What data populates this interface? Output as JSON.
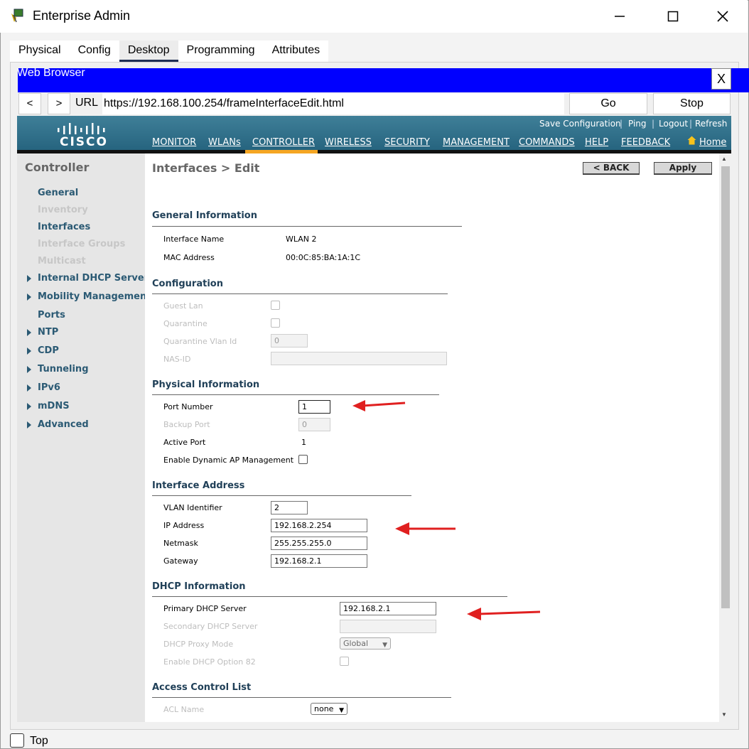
{
  "window": {
    "title": "Enterprise Admin"
  },
  "tabs": [
    {
      "label": "Physical"
    },
    {
      "label": "Config"
    },
    {
      "label": "Desktop"
    },
    {
      "label": "Programming"
    },
    {
      "label": "Attributes"
    }
  ],
  "browser": {
    "title": "Web Browser",
    "close_label": "X",
    "back_label": "<",
    "forward_label": ">",
    "url_label": "URL",
    "url": "https://192.168.100.254/frameInterfaceEdit.html",
    "go_label": "Go",
    "stop_label": "Stop"
  },
  "cisco": {
    "brand": "CISCO",
    "top_links": [
      "Save Configuration",
      "Ping",
      "Logout",
      "Refresh"
    ],
    "menu": [
      "MONITOR",
      "WLANs",
      "CONTROLLER",
      "WIRELESS",
      "SECURITY",
      "MANAGEMENT",
      "COMMANDS",
      "HELP",
      "FEEDBACK"
    ],
    "home_label": "Home",
    "active_menu": "CONTROLLER"
  },
  "sidebar": {
    "title": "Controller",
    "items": [
      {
        "label": "General",
        "disabled": false,
        "arrow": false
      },
      {
        "label": "Inventory",
        "disabled": true,
        "arrow": false
      },
      {
        "label": "Interfaces",
        "disabled": false,
        "arrow": false
      },
      {
        "label": "Interface Groups",
        "disabled": true,
        "arrow": false
      },
      {
        "label": "Multicast",
        "disabled": true,
        "arrow": false
      },
      {
        "label": "Internal DHCP Server",
        "disabled": false,
        "arrow": true
      },
      {
        "label": "Mobility Management",
        "disabled": false,
        "arrow": true
      },
      {
        "label": "Ports",
        "disabled": false,
        "arrow": false
      },
      {
        "label": "NTP",
        "disabled": false,
        "arrow": true
      },
      {
        "label": "CDP",
        "disabled": false,
        "arrow": true
      },
      {
        "label": "Tunneling",
        "disabled": false,
        "arrow": true
      },
      {
        "label": "IPv6",
        "disabled": false,
        "arrow": true
      },
      {
        "label": "mDNS",
        "disabled": false,
        "arrow": true
      },
      {
        "label": "Advanced",
        "disabled": false,
        "arrow": true
      }
    ]
  },
  "page": {
    "heading": "Interfaces > Edit",
    "back_label": "< BACK",
    "apply_label": "Apply"
  },
  "general": {
    "title": "General Information",
    "interface_name_label": "Interface Name",
    "interface_name": "WLAN 2",
    "mac_label": "MAC Address",
    "mac": "00:0C:85:BA:1A:1C"
  },
  "configuration": {
    "title": "Configuration",
    "guest_lan_label": "Guest Lan",
    "quarantine_label": "Quarantine",
    "quarantine_vlan_label": "Quarantine Vlan Id",
    "quarantine_vlan": "0",
    "nas_id_label": "NAS-ID",
    "nas_id": ""
  },
  "physical": {
    "title": "Physical Information",
    "port_number_label": "Port Number",
    "port_number": "1",
    "backup_port_label": "Backup Port",
    "backup_port": "0",
    "active_port_label": "Active Port",
    "active_port": "1",
    "dynamic_ap_label": "Enable Dynamic AP Management"
  },
  "address": {
    "title": "Interface Address",
    "vlan_label": "VLAN Identifier",
    "vlan": "2",
    "ip_label": "IP Address",
    "ip": "192.168.2.254",
    "netmask_label": "Netmask",
    "netmask": "255.255.255.0",
    "gateway_label": "Gateway",
    "gateway": "192.168.2.1"
  },
  "dhcp": {
    "title": "DHCP Information",
    "primary_label": "Primary DHCP Server",
    "primary": "192.168.2.1",
    "secondary_label": "Secondary DHCP Server",
    "secondary": "",
    "proxy_label": "DHCP Proxy Mode",
    "proxy": "Global",
    "option82_label": "Enable DHCP Option 82"
  },
  "acl": {
    "title": "Access Control List",
    "name_label": "ACL Name",
    "name": "none"
  },
  "footer": {
    "top_label": "Top"
  },
  "colors": {
    "browser_title_bar": "#0000ff",
    "cisco_header": "#2f6f8a",
    "active_menu_bar": "#f5a623",
    "arrow": "#e02020",
    "section_title": "#1f3f57"
  }
}
